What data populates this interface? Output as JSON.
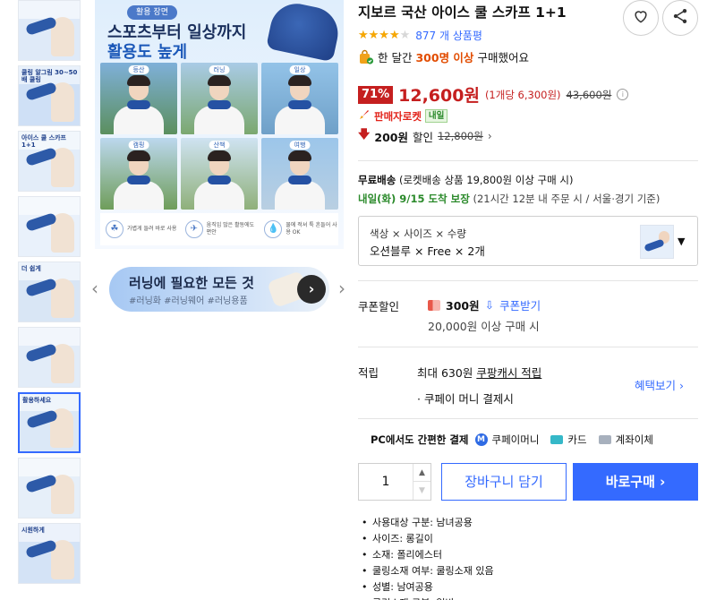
{
  "gallery": {
    "thumbnails": [
      {
        "label": ""
      },
      {
        "label": "쿨링 알그림 30~50배 쿨링"
      },
      {
        "label": "아이스 쿨 스카프 1+1"
      },
      {
        "label": ""
      },
      {
        "label": "더 쉽게"
      },
      {
        "label": ""
      },
      {
        "label": "활용하세요"
      },
      {
        "label": ""
      },
      {
        "label": "시원하게"
      }
    ],
    "selected_index": 6,
    "main_image": {
      "pill": "활용 장면",
      "headline_1": "스포츠부터 일상까지",
      "headline_2": "활용도 높게",
      "scenes": [
        "등산",
        "러닝",
        "일상",
        "캠핑",
        "산책",
        "여행"
      ],
      "features": [
        {
          "icon": "☘",
          "text": "가볍게 들려 바로 사용"
        },
        {
          "icon": "✈",
          "text": "움직임 많은 활동에도 편안"
        },
        {
          "icon": "💧",
          "text": "물에 적셔 툭 흔들어 사용 OK"
        }
      ]
    },
    "banner": {
      "title": "러닝에 필요한 모든 것",
      "tags": "#러닝화 #러닝웨어 #러닝용품",
      "prev": "‹",
      "next": "›"
    }
  },
  "product": {
    "title": "지보르 국산 아이스 쿨 스카프 1+1",
    "rating": {
      "stars": "★★★★★",
      "value_fraction": 0.8,
      "reviews": "877 개 상품평"
    },
    "sold": {
      "prefix": "한 달간",
      "count": "300명 이상",
      "suffix": "구매했어요"
    },
    "price": {
      "discount": "71%",
      "sale": "12,600원",
      "unit": "(1개당 6,300원)",
      "original": "43,600원",
      "info": "i"
    },
    "rocket": {
      "label": "판매자로켓",
      "badge": "내일"
    },
    "instant_discount": {
      "arrow": "🡇",
      "amount": "200원",
      "label": "할인",
      "original": "12,800원",
      "chev": "›"
    }
  },
  "shipping": {
    "free_label": "무료배송",
    "free_detail": "(로켓배송 상품 19,800원 이상 구매 시)",
    "arrival": "내일(화) 9/15 도착 보장",
    "arrival_note": "(21시간 12분 내 주문 시 / 서울⋅경기 기준)"
  },
  "options": {
    "label": "색상 × 사이즈 × 수량",
    "value": "오션블루 × Free × 2개",
    "caret": "▼"
  },
  "coupon": {
    "label": "쿠폰할인",
    "amount": "300원",
    "download_icon": "⇩",
    "download": "쿠폰받기",
    "condition": "20,000원 이상 구매 시"
  },
  "points": {
    "label": "적립",
    "max_prefix": "최대 630원",
    "max_link": "쿠팡캐시 적립",
    "pay": "· 쿠페이 머니 결제시",
    "benefits": "혜택보기 ›"
  },
  "payment": {
    "title": "PC에서도 간편한 결제",
    "methods": [
      "쿠페이머니",
      "카드",
      "계좌이체"
    ],
    "m_icon": "M"
  },
  "purchase": {
    "quantity": "1",
    "up": "▲",
    "down": "▼",
    "cart": "장바구니 담기",
    "buy": "바로구매 ›"
  },
  "specs": [
    "사용대상 구분: 남녀공용",
    "사이즈: 롱길이",
    "소재: 폴리에스터",
    "쿨링소재 여부: 쿨링소재 있음",
    "성별: 남여공용",
    "쿨링소재 구분: 일반"
  ],
  "colors": {
    "accent": "#346aff",
    "price_red": "#c51f1f",
    "green": "#2b8a2b",
    "star": "#f7a701"
  },
  "icons": {
    "wish": "heart-icon",
    "share": "share-icon",
    "sold": "shopping-bag-icon",
    "rocket": "rocket-icon"
  }
}
